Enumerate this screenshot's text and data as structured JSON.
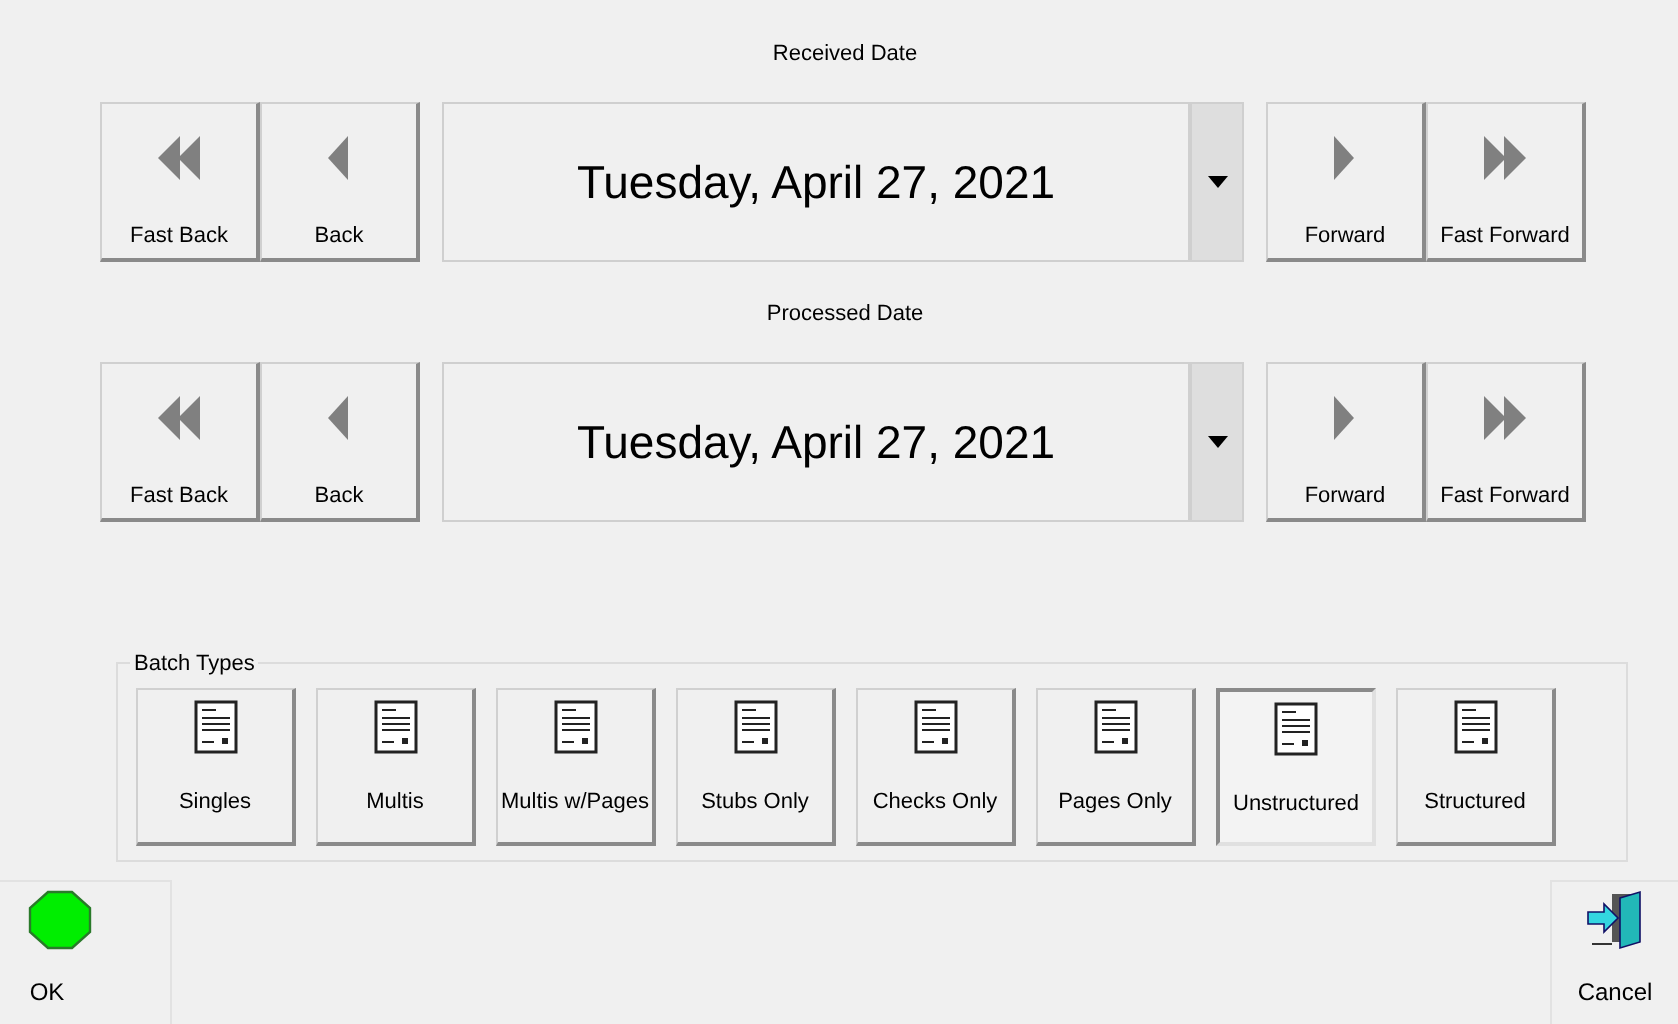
{
  "date_pickers": [
    {
      "label": "Received Date",
      "value": "Tuesday, April 27, 2021",
      "buttons": [
        {
          "kind": "fast-back",
          "label": "Fast Back"
        },
        {
          "kind": "back",
          "label": "Back"
        },
        {
          "kind": "forward",
          "label": "Forward"
        },
        {
          "kind": "fast-forward",
          "label": "Fast Forward"
        }
      ]
    },
    {
      "label": "Processed Date",
      "value": "Tuesday, April 27, 2021",
      "buttons": [
        {
          "kind": "fast-back",
          "label": "Fast Back"
        },
        {
          "kind": "back",
          "label": "Back"
        },
        {
          "kind": "forward",
          "label": "Forward"
        },
        {
          "kind": "fast-forward",
          "label": "Fast Forward"
        }
      ]
    }
  ],
  "batch_types": {
    "title": "Batch Types",
    "items": [
      {
        "label": "Singles",
        "selected": false
      },
      {
        "label": "Multis",
        "selected": false
      },
      {
        "label": "Multis w/Pages",
        "selected": false
      },
      {
        "label": "Stubs Only",
        "selected": false
      },
      {
        "label": "Checks Only",
        "selected": false
      },
      {
        "label": "Pages Only",
        "selected": false
      },
      {
        "label": "Unstructured",
        "selected": true
      },
      {
        "label": "Structured",
        "selected": false
      }
    ]
  },
  "ok_button": {
    "label": "OK"
  },
  "cancel_button": {
    "label": "Cancel"
  }
}
